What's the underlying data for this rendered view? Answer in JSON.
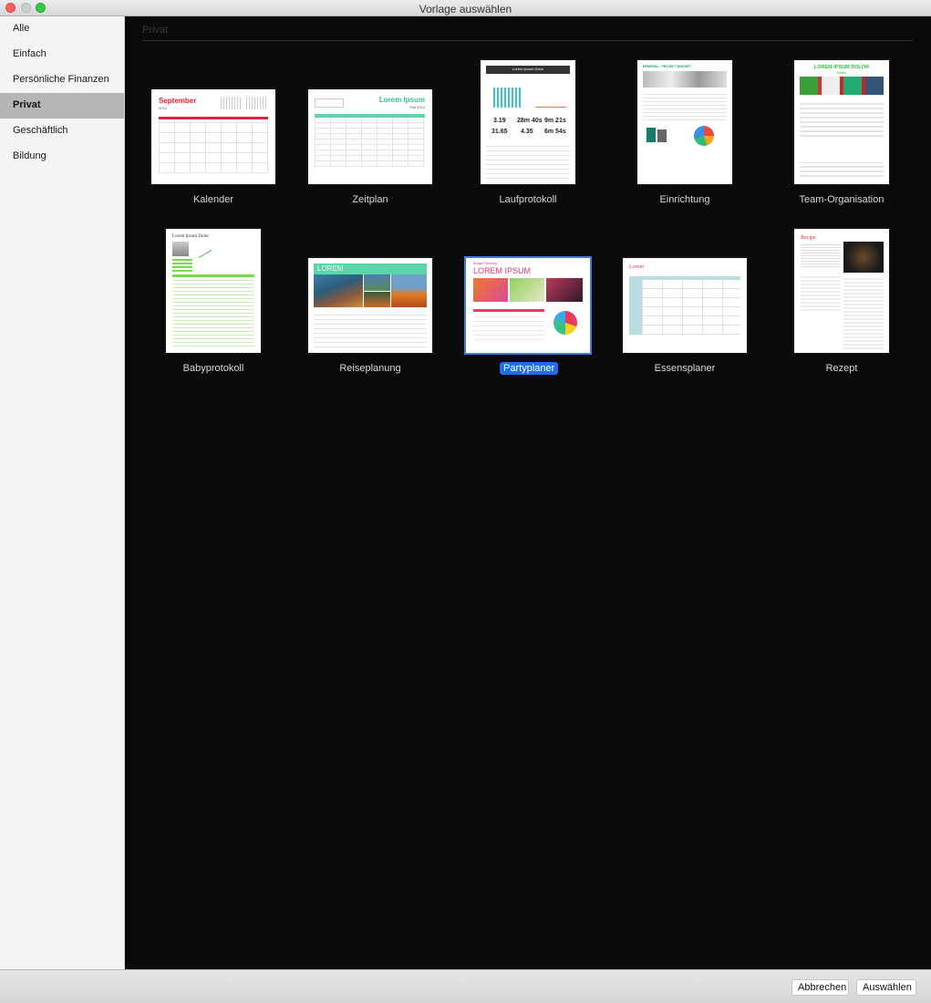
{
  "window": {
    "title": "Vorlage auswählen"
  },
  "sidebar": {
    "items": [
      {
        "label": "Alle",
        "active": false
      },
      {
        "label": "Einfach",
        "active": false
      },
      {
        "label": "Persönliche Finanzen",
        "active": false
      },
      {
        "label": "Privat",
        "active": true
      },
      {
        "label": "Geschäftlich",
        "active": false
      },
      {
        "label": "Bildung",
        "active": false
      }
    ]
  },
  "main": {
    "section_title": "Privat",
    "templates": [
      {
        "label": "Kalender",
        "thumb_text": [
          "September",
          "2014"
        ]
      },
      {
        "label": "Zeitplan",
        "thumb_text": [
          "Lorem Ipsum",
          "Fall 2014"
        ]
      },
      {
        "label": "Laufprotokoll",
        "thumb_text": [
          "Lorem Ipsum Dolor",
          "3.19",
          "28m 40s",
          "9m 21s",
          "31.65",
          "4.35",
          "6m 54s"
        ]
      },
      {
        "label": "Einrichtung",
        "thumb_text": [
          "REMODEL - PROJECT BUDGET"
        ]
      },
      {
        "label": "Team-Organisation",
        "thumb_text": [
          "LOREM IPSUM DOLOR",
          "Roster"
        ]
      },
      {
        "label": "Babyprotokoll",
        "thumb_text": [
          "Lorem Ipsum Dolor"
        ]
      },
      {
        "label": "Reiseplanung",
        "thumb_text": [
          "LOREM"
        ]
      },
      {
        "label": "Partyplaner",
        "selected": true,
        "thumb_text": [
          "Budget Planning",
          "LOREM IPSUM"
        ]
      },
      {
        "label": "Essensplaner",
        "thumb_text": [
          "Lorem"
        ]
      },
      {
        "label": "Rezept",
        "thumb_text": [
          "Recipe"
        ]
      }
    ]
  },
  "footer": {
    "cancel_label": "Abbrechen",
    "choose_label": "Auswählen"
  },
  "colors": {
    "selection": "#1c6cf0",
    "sidebar_active": "#b5b5b5",
    "calendar_red": "#e0243a",
    "green_accent": "#2fc58f"
  }
}
